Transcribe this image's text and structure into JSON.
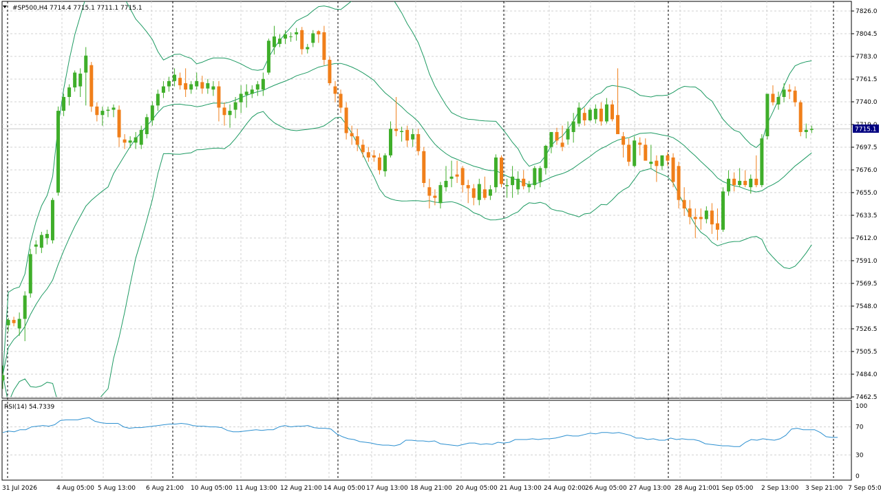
{
  "header": {
    "symbol": "#SP500,H4",
    "ohlc": "7714.4 7715.1 7711.1 7715.1",
    "menu_icon": "triangle-down-icon"
  },
  "price_tag": "7715.1",
  "rsi_label": "RSI(14) 54.7339",
  "colors": {
    "bull": "#3fae2a",
    "bear": "#f07f1a",
    "band": "#1d9a62",
    "rsi": "#2b8fd0",
    "grid": "#d0d0d0",
    "tag_bg": "#000080"
  },
  "chart_data": [
    {
      "type": "candlestick",
      "title": "#SP500,H4",
      "ylim": [
        7462.5,
        7826.0
      ],
      "y_ticks": [
        "7826.0",
        "7804.5",
        "7783.0",
        "7761.5",
        "7740.0",
        "7719.0",
        "7697.5",
        "7676.0",
        "7655.0",
        "7633.5",
        "7612.0",
        "7591.0",
        "7569.5",
        "7548.0",
        "7526.5",
        "7505.5",
        "7484.0",
        "7462.5"
      ],
      "x_ticks": [
        "31 Jul 2026",
        "4 Aug 05:00",
        "5 Aug 13:00",
        "6 Aug 21:00",
        "10 Aug 05:00",
        "11 Aug 13:00",
        "12 Aug 21:00",
        "14 Aug 05:00",
        "17 Aug 13:00",
        "18 Aug 21:00",
        "20 Aug 05:00",
        "21 Aug 13:00",
        "24 Aug 02:00",
        "26 Aug 05:00",
        "27 Aug 13:00",
        "28 Aug 21:00",
        "1 Sep 05:00",
        "2 Sep 13:00",
        "3 Sep 21:00",
        "7 Sep 05:00"
      ],
      "candles": [
        [
          7478,
          7492,
          7470,
          7483
        ],
        [
          7530,
          7537,
          7524,
          7535
        ],
        [
          7535,
          7538,
          7529,
          7532
        ],
        [
          7527,
          7542,
          7520,
          7536
        ],
        [
          7536,
          7562,
          7515,
          7558
        ],
        [
          7560,
          7602,
          7556,
          7597
        ],
        [
          7604,
          7610,
          7597,
          7606
        ],
        [
          7603,
          7618,
          7598,
          7615
        ],
        [
          7612,
          7620,
          7606,
          7616
        ],
        [
          7610,
          7650,
          7607,
          7648
        ],
        [
          7655,
          7736,
          7652,
          7732
        ],
        [
          7732,
          7748,
          7727,
          7745
        ],
        [
          7745,
          7757,
          7737,
          7754
        ],
        [
          7754,
          7770,
          7750,
          7768
        ],
        [
          7755,
          7772,
          7745,
          7767
        ],
        [
          7768,
          7792,
          7737,
          7784
        ],
        [
          7775,
          7778,
          7731,
          7736
        ],
        [
          7736,
          7740,
          7722,
          7728
        ],
        [
          7728,
          7736,
          7718,
          7732
        ],
        [
          7732,
          7736,
          7726,
          7733
        ],
        [
          7733,
          7738,
          7726,
          7735
        ],
        [
          7733,
          7737,
          7698,
          7707
        ],
        [
          7705,
          7710,
          7696,
          7702
        ],
        [
          7702,
          7708,
          7697,
          7704
        ],
        [
          7702,
          7712,
          7696,
          7707
        ],
        [
          7700,
          7718,
          7696,
          7714
        ],
        [
          7710,
          7729,
          7706,
          7726
        ],
        [
          7723,
          7741,
          7718,
          7737
        ],
        [
          7737,
          7752,
          7732,
          7748
        ],
        [
          7749,
          7760,
          7744,
          7755
        ],
        [
          7755,
          7764,
          7750,
          7760
        ],
        [
          7760,
          7772,
          7755,
          7766
        ],
        [
          7763,
          7768,
          7752,
          7756
        ],
        [
          7758,
          7772,
          7745,
          7752
        ],
        [
          7752,
          7760,
          7748,
          7757
        ],
        [
          7755,
          7768,
          7752,
          7760
        ],
        [
          7759,
          7765,
          7748,
          7753
        ],
        [
          7753,
          7762,
          7748,
          7758
        ],
        [
          7752,
          7760,
          7746,
          7755
        ],
        [
          7755,
          7760,
          7722,
          7735
        ],
        [
          7735,
          7740,
          7718,
          7728
        ],
        [
          7728,
          7738,
          7716,
          7732
        ],
        [
          7733,
          7745,
          7725,
          7740
        ],
        [
          7740,
          7756,
          7730,
          7748
        ],
        [
          7747,
          7757,
          7735,
          7750
        ],
        [
          7748,
          7756,
          7744,
          7752
        ],
        [
          7752,
          7760,
          7746,
          7757
        ],
        [
          7752,
          7768,
          7746,
          7762
        ],
        [
          7768,
          7800,
          7766,
          7798
        ],
        [
          7792,
          7812,
          7785,
          7802
        ],
        [
          7795,
          7804,
          7792,
          7800
        ],
        [
          7800,
          7808,
          7795,
          7804
        ],
        [
          7802,
          7806,
          7797,
          7802
        ],
        [
          7804,
          7810,
          7798,
          7806
        ],
        [
          7808,
          7811,
          7785,
          7790
        ],
        [
          7790,
          7795,
          7786,
          7792
        ],
        [
          7796,
          7808,
          7792,
          7805
        ],
        [
          7807,
          7808,
          7796,
          7804
        ],
        [
          7806,
          7812,
          7775,
          7780
        ],
        [
          7780,
          7783,
          7756,
          7758
        ],
        [
          7755,
          7760,
          7740,
          7748
        ],
        [
          7748,
          7752,
          7730,
          7735
        ],
        [
          7735,
          7740,
          7705,
          7711
        ],
        [
          7711,
          7718,
          7700,
          7708
        ],
        [
          7708,
          7715,
          7694,
          7700
        ],
        [
          7700,
          7705,
          7688,
          7693
        ],
        [
          7693,
          7698,
          7684,
          7688
        ],
        [
          7690,
          7695,
          7684,
          7688
        ],
        [
          7688,
          7692,
          7672,
          7676
        ],
        [
          7675,
          7692,
          7670,
          7690
        ],
        [
          7690,
          7722,
          7688,
          7715
        ],
        [
          7715,
          7745,
          7708,
          7713
        ],
        [
          7712,
          7717,
          7703,
          7713
        ],
        [
          7714,
          7718,
          7698,
          7704
        ],
        [
          7705,
          7715,
          7698,
          7710
        ],
        [
          7710,
          7715,
          7690,
          7694
        ],
        [
          7694,
          7698,
          7660,
          7664
        ],
        [
          7660,
          7668,
          7640,
          7652
        ],
        [
          7652,
          7658,
          7643,
          7650
        ],
        [
          7645,
          7665,
          7640,
          7662
        ],
        [
          7660,
          7680,
          7656,
          7666
        ],
        [
          7668,
          7685,
          7660,
          7670
        ],
        [
          7672,
          7685,
          7664,
          7670
        ],
        [
          7678,
          7680,
          7655,
          7662
        ],
        [
          7662,
          7667,
          7645,
          7659
        ],
        [
          7659,
          7663,
          7643,
          7650
        ],
        [
          7648,
          7668,
          7643,
          7663
        ],
        [
          7658,
          7670,
          7648,
          7650
        ],
        [
          7652,
          7662,
          7648,
          7658
        ],
        [
          7660,
          7691,
          7655,
          7688
        ],
        [
          7688,
          7690,
          7660,
          7663
        ],
        [
          7661,
          7668,
          7650,
          7662
        ],
        [
          7662,
          7680,
          7650,
          7670
        ],
        [
          7658,
          7675,
          7653,
          7668
        ],
        [
          7668,
          7676,
          7658,
          7661
        ],
        [
          7660,
          7666,
          7655,
          7663
        ],
        [
          7662,
          7680,
          7658,
          7678
        ],
        [
          7665,
          7680,
          7660,
          7678
        ],
        [
          7678,
          7700,
          7672,
          7699
        ],
        [
          7698,
          7710,
          7692,
          7712
        ],
        [
          7712,
          7716,
          7700,
          7704
        ],
        [
          7702,
          7718,
          7694,
          7698
        ],
        [
          7705,
          7722,
          7700,
          7715
        ],
        [
          7712,
          7730,
          7702,
          7722
        ],
        [
          7720,
          7740,
          7717,
          7735
        ],
        [
          7730,
          7735,
          7718,
          7723
        ],
        [
          7723,
          7735,
          7722,
          7733
        ],
        [
          7724,
          7738,
          7720,
          7734
        ],
        [
          7734,
          7740,
          7718,
          7722
        ],
        [
          7722,
          7744,
          7720,
          7738
        ],
        [
          7738,
          7742,
          7722,
          7724
        ],
        [
          7728,
          7772,
          7715,
          7710
        ],
        [
          7708,
          7712,
          7688,
          7700
        ],
        [
          7700,
          7706,
          7680,
          7684
        ],
        [
          7680,
          7708,
          7679,
          7704
        ],
        [
          7702,
          7707,
          7690,
          7700
        ],
        [
          7700,
          7706,
          7690,
          7685
        ],
        [
          7682,
          7700,
          7678,
          7684
        ],
        [
          7685,
          7690,
          7665,
          7680
        ],
        [
          7680,
          7690,
          7676,
          7690
        ],
        [
          7690,
          7693,
          7680,
          7685
        ],
        [
          7688,
          7692,
          7660,
          7665
        ],
        [
          7680,
          7684,
          7640,
          7648
        ],
        [
          7648,
          7660,
          7633,
          7640
        ],
        [
          7640,
          7648,
          7625,
          7632
        ],
        [
          7632,
          7640,
          7612,
          7630
        ],
        [
          7632,
          7640,
          7620,
          7630
        ],
        [
          7630,
          7642,
          7626,
          7638
        ],
        [
          7638,
          7645,
          7616,
          7625
        ],
        [
          7626,
          7640,
          7610,
          7620
        ],
        [
          7620,
          7660,
          7618,
          7656
        ],
        [
          7656,
          7676,
          7652,
          7668
        ],
        [
          7668,
          7674,
          7656,
          7662
        ],
        [
          7662,
          7678,
          7660,
          7666
        ],
        [
          7666,
          7676,
          7660,
          7662
        ],
        [
          7660,
          7672,
          7654,
          7668
        ],
        [
          7668,
          7690,
          7660,
          7662
        ],
        [
          7662,
          7710,
          7660,
          7706
        ],
        [
          7708,
          7740,
          7705,
          7748
        ],
        [
          7748,
          7756,
          7737,
          7740
        ],
        [
          7738,
          7750,
          7733,
          7745
        ],
        [
          7745,
          7758,
          7740,
          7752
        ],
        [
          7752,
          7757,
          7743,
          7750
        ],
        [
          7751,
          7755,
          7736,
          7740
        ],
        [
          7740,
          7742,
          7708,
          7712
        ],
        [
          7712,
          7720,
          7706,
          7714
        ],
        [
          7714,
          7718,
          7711,
          7715
        ]
      ]
    },
    {
      "type": "line",
      "title": "RSI(14) 54.7339",
      "ylim": [
        0,
        100
      ],
      "y_ticks": [
        "100",
        "70",
        "30",
        "0"
      ],
      "values": [
        62,
        64,
        63,
        66,
        66,
        70,
        71,
        72,
        71,
        73,
        79,
        80,
        80,
        80,
        82,
        83,
        78,
        76,
        75,
        75,
        75,
        70,
        68,
        69,
        69,
        70,
        71,
        72,
        73,
        74,
        74,
        75,
        74,
        72,
        71,
        71,
        70,
        70,
        69,
        65,
        63,
        63,
        64,
        65,
        66,
        65,
        66,
        66,
        70,
        72,
        70,
        71,
        71,
        72,
        69,
        68,
        68,
        67,
        60,
        56,
        53,
        52,
        49,
        48,
        47,
        45,
        44,
        44,
        43,
        45,
        51,
        51,
        50,
        50,
        49,
        50,
        46,
        45,
        44,
        43,
        45,
        47,
        47,
        45,
        46,
        45,
        48,
        47,
        48,
        52,
        52,
        52,
        53,
        52,
        53,
        53,
        54,
        56,
        58,
        57,
        57,
        59,
        61,
        60,
        62,
        62,
        61,
        62,
        60,
        58,
        54,
        54,
        52,
        53,
        51,
        51,
        54,
        52,
        53,
        52,
        52,
        50,
        46,
        45,
        44,
        43,
        43,
        42,
        42,
        48,
        52,
        51,
        53,
        52,
        51,
        53,
        58,
        67,
        68,
        66,
        66,
        66,
        62,
        56,
        55,
        55
      ]
    }
  ]
}
